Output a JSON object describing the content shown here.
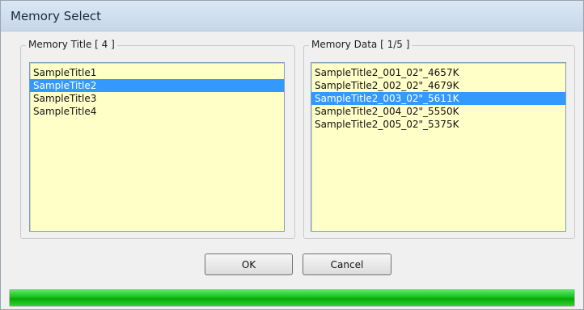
{
  "window": {
    "title": "Memory Select"
  },
  "memory_title": {
    "label": "Memory Title [ 4 ]",
    "items": [
      "SampleTitle1",
      "SampleTitle2",
      "SampleTitle3",
      "SampleTitle4"
    ],
    "selected_index": 1
  },
  "memory_data": {
    "label": "Memory Data [ 1/5 ]",
    "items": [
      "SampleTitle2_001_02\"_4657K",
      "SampleTitle2_002_02\"_4679K",
      "SampleTitle2_003_02\"_5611K",
      "SampleTitle2_004_02\"_5550K",
      "SampleTitle2_005_02\"_5375K"
    ],
    "selected_index": 2
  },
  "buttons": {
    "ok": "OK",
    "cancel": "Cancel"
  },
  "progress": {
    "fraction": 1.0
  },
  "colors": {
    "selection": "#3399ff",
    "list_background": "#ffffc8",
    "progress_fill": "#19c119"
  }
}
